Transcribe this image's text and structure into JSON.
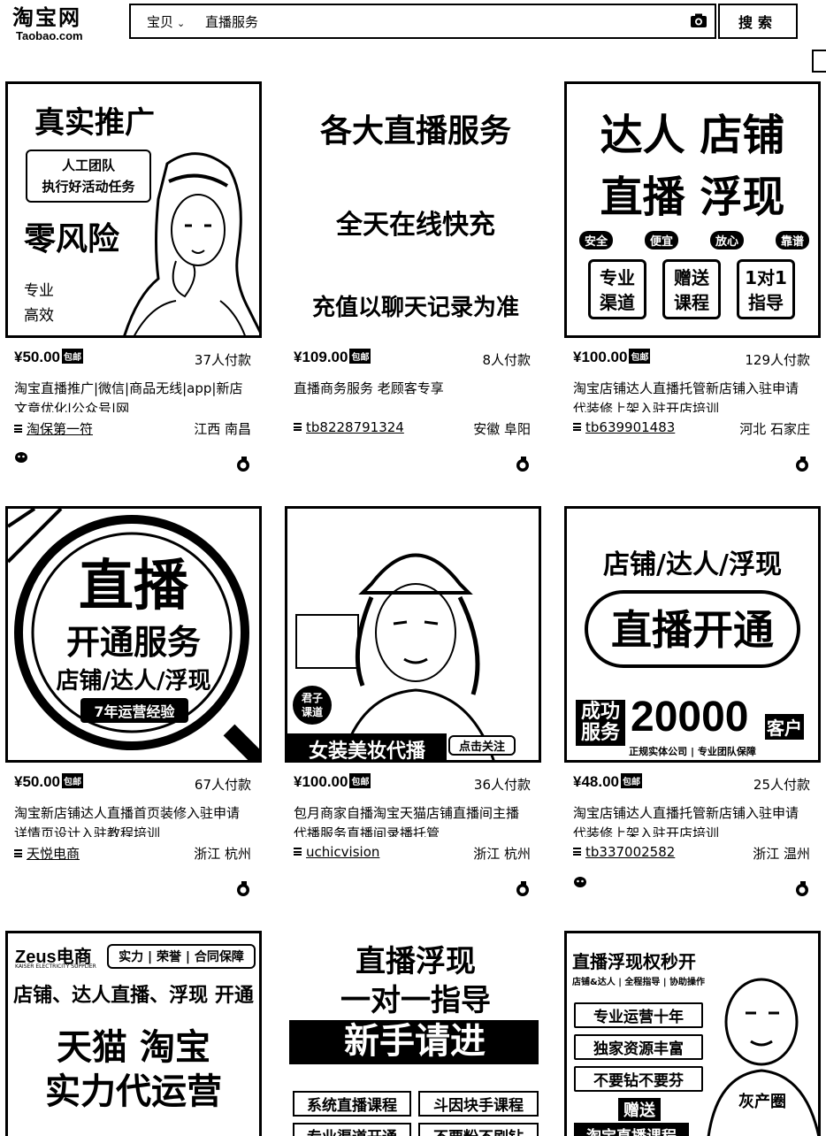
{
  "header": {
    "logo_cn": "淘宝网",
    "logo_en": "Taobao.com",
    "search_scope": "宝贝",
    "search_query": "直播服务",
    "search_button": "搜索"
  },
  "badge_label": "包邮",
  "products": [
    {
      "price": "¥50.00",
      "sales": "37人付款",
      "title": "淘宝直播推广|微信|商品无线|app|新店文章优化|公众号|网",
      "shop": "淘保第一符",
      "location": "江西 南昌",
      "image_text": {
        "headline": "真实推广",
        "box": "人工团队\n执行好活动任务",
        "big": "零风险",
        "side": "专业\n高效"
      }
    },
    {
      "price": "¥109.00",
      "sales": "8人付款",
      "title": "直播商务服务 老顾客专享",
      "shop": "tb8228791324",
      "location": "安徽 阜阳",
      "image_text": {
        "line1": "各大直播服务",
        "line2": "全天在线快充",
        "line3": "充值以聊天记录为准"
      }
    },
    {
      "price": "¥100.00",
      "sales": "129人付款",
      "title": "淘宝店铺达人直播托管新店铺入驻申请代装修上架入驻开店培训",
      "shop": "tb639901483",
      "location": "河北 石家庄",
      "image_text": {
        "row1": "达人 店铺",
        "row2": "直播 浮现",
        "tags": [
          "安全",
          "便宜",
          "放心",
          "靠谱"
        ],
        "boxes": [
          "专业\n渠道",
          "赠送\n课程",
          "1对1\n指导"
        ]
      }
    },
    {
      "price": "¥50.00",
      "sales": "67人付款",
      "title": "淘宝新店铺达人直播首页装修入驻申请详情页设计入驻教程培训",
      "shop": "天悦电商",
      "location": "浙江 杭州",
      "image_text": {
        "big": "直播",
        "mid": "开通服务",
        "sub": "店铺/达人/浮现",
        "ribbon": "7年运营经验"
      }
    },
    {
      "price": "¥100.00",
      "sales": "36人付款",
      "title": "包月商家自播淘宝天猫店铺直播间主播代播服务直播间录播托管",
      "shop": "uchicvision",
      "location": "浙江 杭州",
      "image_text": {
        "corner": "君子\n课道",
        "banner": "女装美妆代播",
        "follow": "点击关注"
      }
    },
    {
      "price": "¥48.00",
      "sales": "25人付款",
      "title": "淘宝店铺达人直播托管新店铺入驻申请代装修上架入驻开店培训",
      "shop": "tb337002582",
      "location": "浙江 温州",
      "image_text": {
        "top": "店铺/达人/浮现",
        "center": "直播开通",
        "left": "成功\n服务",
        "number": "20000",
        "unit": "客户",
        "footer": "正规实体公司 | 专业团队保障"
      }
    },
    {
      "image_text": {
        "brand": "Zeus电商",
        "brand_sub": "KAISER ELECTRICITY SUPPLIER",
        "tags": "实力 | 荣誉 | 合同保障",
        "line": "店铺、达人直播、浮现 开通",
        "big1": "天猫 淘宝",
        "big2": "实力代运营"
      }
    },
    {
      "image_text": {
        "line1": "直播浮现",
        "line2": "一对一指导",
        "line3": "新手请进",
        "box1": "系统直播课程",
        "box2": "斗因块手课程",
        "box3": "专业渠道开通",
        "box4": "不要粉不刷钻"
      }
    },
    {
      "image_text": {
        "title": "直播浮现权秒开",
        "sub": "店铺&达人 | 全程指导 | 协助操作",
        "b1": "专业运营十年",
        "b2": "独家资源丰富",
        "b3": "不要钻不要芬",
        "gift": "赠送",
        "bottom": "淘宝直播课程",
        "watermark": "灰产圈"
      }
    }
  ]
}
